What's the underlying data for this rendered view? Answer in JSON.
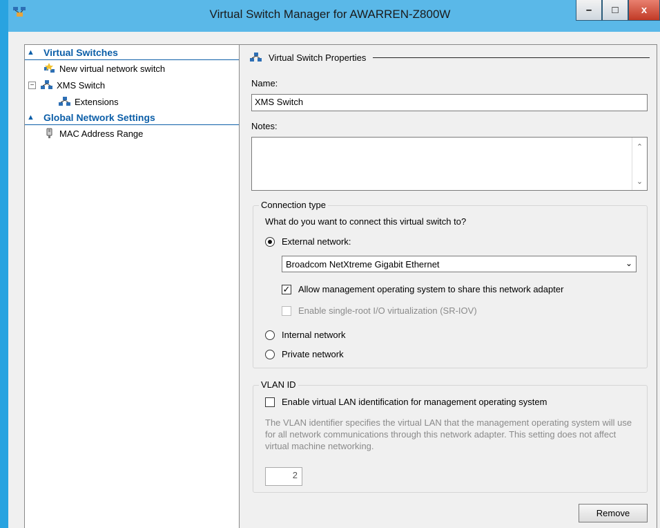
{
  "window": {
    "title": "Virtual Switch Manager for AWARREN-Z800W",
    "minimize": "–",
    "maximize": "□",
    "close": "x"
  },
  "tree": {
    "virtual_switches_header": "Virtual Switches",
    "new_switch": "New virtual network switch",
    "xms_switch": "XMS Switch",
    "extensions": "Extensions",
    "global_settings_header": "Global Network Settings",
    "mac_range": "MAC Address Range",
    "expander": "−"
  },
  "props": {
    "section_title": "Virtual Switch Properties",
    "name_label": "Name:",
    "name_value": "XMS Switch",
    "notes_label": "Notes:",
    "notes_value": "",
    "connection": {
      "legend": "Connection type",
      "question": "What do you want to connect this virtual switch to?",
      "external_label": "External network:",
      "adapter": "Broadcom NetXtreme Gigabit Ethernet",
      "allow_mgmt": "Allow management operating system to share this network adapter",
      "sriov": "Enable single-root I/O virtualization (SR-IOV)",
      "internal_label": "Internal network",
      "private_label": "Private network",
      "selected": "external",
      "allow_mgmt_checked": true,
      "sriov_checked": false
    },
    "vlan": {
      "legend": "VLAN ID",
      "enable_label": "Enable virtual LAN identification for management operating system",
      "enable_checked": false,
      "description": "The VLAN identifier specifies the virtual LAN that the management operating system will use for all network communications through this network adapter. This setting does not affect virtual machine networking.",
      "id_value": "2"
    },
    "remove_button": "Remove"
  },
  "colors": {
    "title_bar": "#5ab8e8",
    "window_frame": "#29a3e0",
    "tree_header": "#0b5ea8",
    "close_button": "#c13a26"
  }
}
